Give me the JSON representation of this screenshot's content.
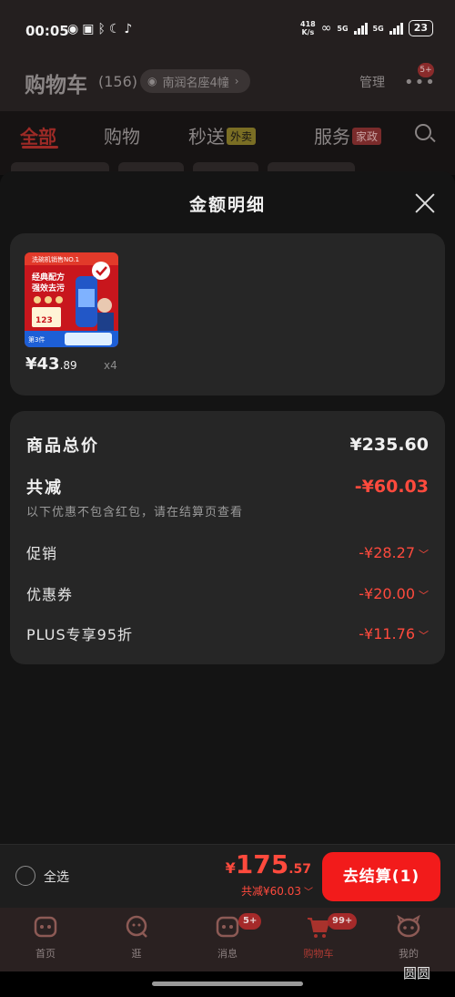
{
  "status_bar": {
    "time": "00:05",
    "net_speed_value": "418",
    "net_speed_unit": "K/s",
    "signal1_label": "5G",
    "signal2_label": "5G",
    "battery": "23"
  },
  "header": {
    "title": "购物车",
    "count": "(156)",
    "address": "南润名座4幢",
    "manage": "管理",
    "more_badge": "5+"
  },
  "tabs": {
    "items": [
      {
        "label": "全部"
      },
      {
        "label": "购物"
      },
      {
        "label": "秒送",
        "tag": "外卖"
      },
      {
        "label": "服务",
        "tag": "家政"
      }
    ]
  },
  "sheet": {
    "title": "金额明细",
    "product": {
      "price_int": "¥43",
      "price_dec": ".89",
      "quantity": "x4",
      "image_text": {
        "banner": "洗碗机销售NO.1",
        "line1": "经典配方",
        "line2": "强效去污",
        "price": "123",
        "badge": "第3件"
      }
    },
    "summary": {
      "goods_total_label": "商品总价",
      "goods_total_value": "¥235.60",
      "reduction_label": "共减",
      "reduction_value": "-¥60.03",
      "note": "以下优惠不包含红包，请在结算页查看",
      "items": [
        {
          "label": "促销",
          "value": "-¥28.27"
        },
        {
          "label": "优惠券",
          "value": "-¥20.00"
        },
        {
          "label": "PLUS专享95折",
          "value": "-¥11.76"
        }
      ]
    }
  },
  "checkout": {
    "select_all": "全选",
    "total_yen": "¥",
    "total_int": "175",
    "total_dec": ".57",
    "saved": "共减¥60.03",
    "button": "去结算(1)"
  },
  "nav": {
    "items": [
      {
        "label": "首页"
      },
      {
        "label": "逛"
      },
      {
        "label": "消息",
        "badge": "5+"
      },
      {
        "label": "购物车",
        "badge": "99+"
      },
      {
        "label": "我的"
      }
    ]
  },
  "watermark": "圆圆",
  "colors": {
    "accent_red": "#ff4a3d",
    "button_red": "#f21b1b",
    "card_bg": "#262626",
    "sheet_bg": "#141414"
  }
}
